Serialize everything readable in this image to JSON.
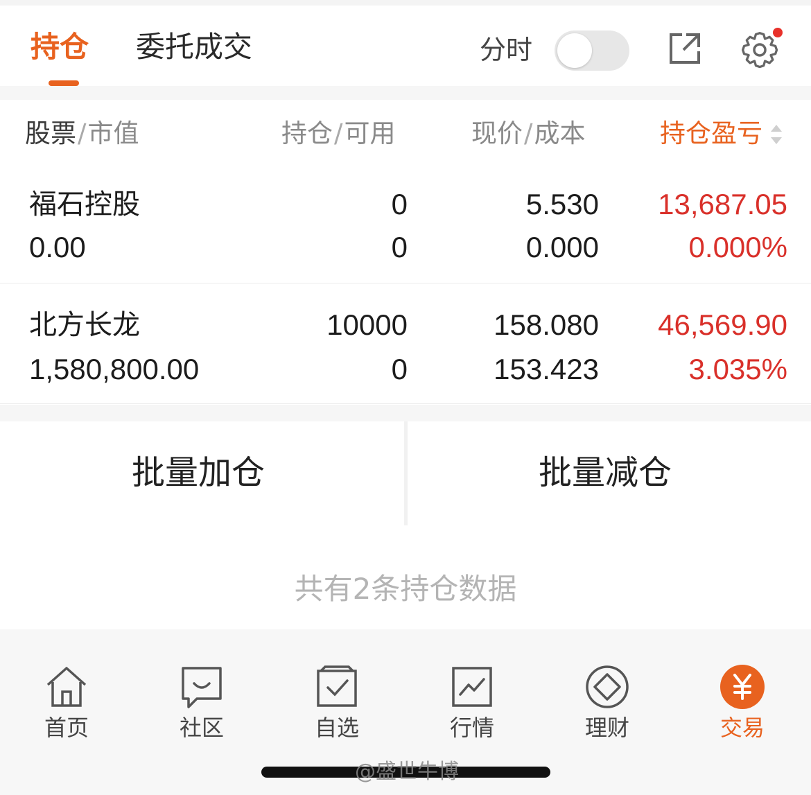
{
  "header": {
    "tabs": [
      {
        "label": "持仓",
        "active": true
      },
      {
        "label": "委托成交",
        "active": false
      }
    ],
    "toggle_label": "分时",
    "toggle_on": false,
    "share_icon": "share-external-icon",
    "settings_icon": "gear-icon",
    "notification_dot_color": "#e8312a",
    "accent_color": "#e8621f"
  },
  "columns": {
    "stock": {
      "main": "股票",
      "sub": "市值"
    },
    "position": {
      "main": "持仓",
      "sub": "可用"
    },
    "price": {
      "main": "现价",
      "sub": "成本"
    },
    "pnl": {
      "main": "持仓盈亏"
    }
  },
  "holdings": [
    {
      "name": "福石控股",
      "market_value": "0.00",
      "position": "0",
      "available": "0",
      "current_price": "5.530",
      "cost": "0.000",
      "pnl": "13,687.05",
      "pnl_pct": "0.000%"
    },
    {
      "name": "北方长龙",
      "market_value": "1,580,800.00",
      "position": "10000",
      "available": "0",
      "current_price": "158.080",
      "cost": "153.423",
      "pnl": "46,569.90",
      "pnl_pct": "3.035%"
    }
  ],
  "actions": {
    "batch_add": "批量加仓",
    "batch_reduce": "批量减仓"
  },
  "summary": "共有2条持仓数据",
  "bottom_nav": [
    {
      "label": "首页",
      "icon": "home-icon",
      "active": false
    },
    {
      "label": "社区",
      "icon": "community-icon",
      "active": false
    },
    {
      "label": "自选",
      "icon": "watchlist-icon",
      "active": false
    },
    {
      "label": "行情",
      "icon": "market-icon",
      "active": false
    },
    {
      "label": "理财",
      "icon": "wealth-icon",
      "active": false
    },
    {
      "label": "交易",
      "icon": "trade-yen-icon",
      "active": true
    }
  ],
  "watermark": "@盛世牛博",
  "pnl_color": "#d9302a"
}
